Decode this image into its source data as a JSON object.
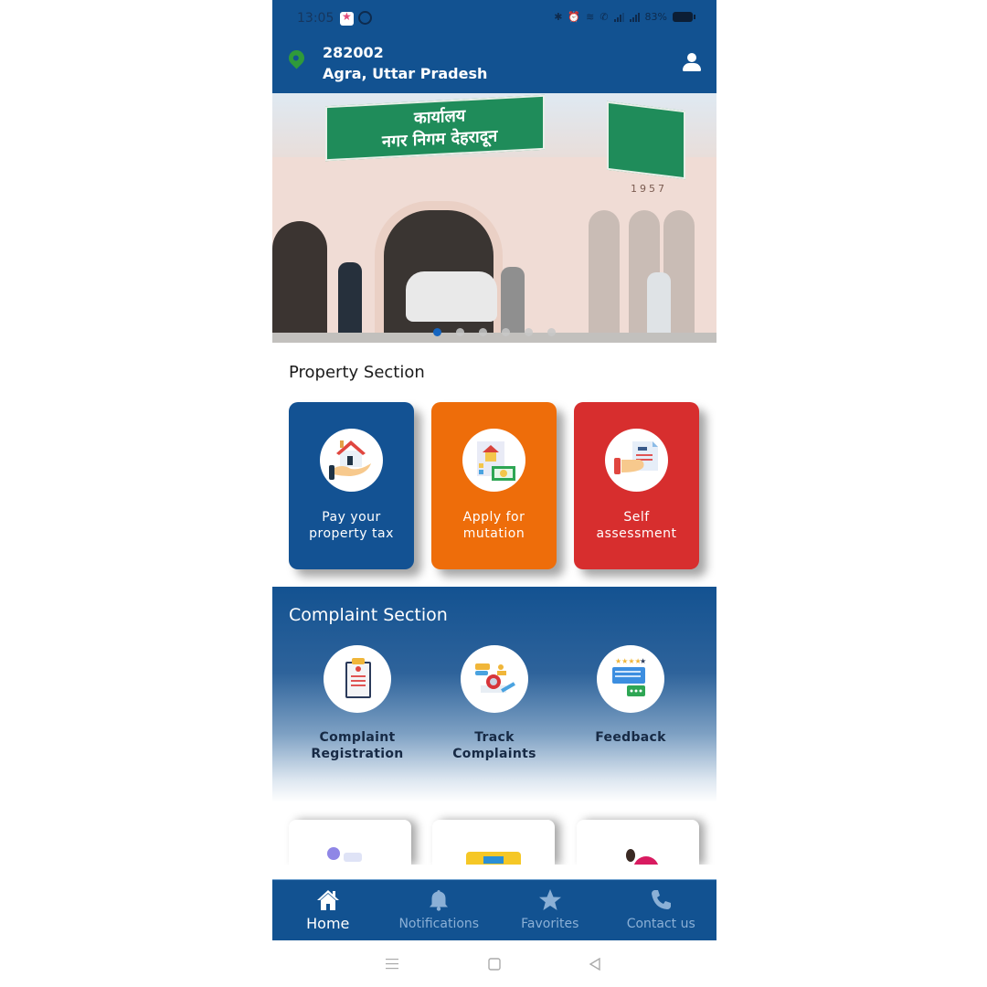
{
  "status_bar": {
    "time": "13:05",
    "notification_icons": [
      "app-notification-icon",
      "whatsapp-icon"
    ],
    "system_icons": [
      "bluetooth-icon",
      "alarm-icon",
      "wifi-icon",
      "volte-call-icon",
      "signal-icon",
      "signal-icon"
    ],
    "battery": "83%"
  },
  "header": {
    "pincode": "282002",
    "location": "Agra, Uttar Pradesh",
    "location_icon": "map-pin-icon",
    "profile_icon": "user-icon"
  },
  "banner": {
    "sign_text_line1": "कार्यालय",
    "sign_text_line2": "नगर निगम देहरादून",
    "building_year": "1957",
    "slide_count": 6,
    "active_slide": 1
  },
  "property_section": {
    "title": "Property Section",
    "cards": [
      {
        "label_line1": "Pay your",
        "label_line2": "property tax",
        "icon": "house-in-hand-icon",
        "color": "#135293"
      },
      {
        "label_line1": "Apply for",
        "label_line2": "mutation",
        "icon": "property-document-money-icon",
        "color": "#ee6d0a"
      },
      {
        "label_line1": "Self",
        "label_line2": "assessment",
        "icon": "hand-holding-document-icon",
        "color": "#d72e2e"
      }
    ]
  },
  "complaint_section": {
    "title": "Complaint Section",
    "items": [
      {
        "label_line1": "Complaint",
        "label_line2": "Registration",
        "icon": "clipboard-complaint-icon"
      },
      {
        "label_line1": "Track",
        "label_line2": "Complaints",
        "icon": "track-certificate-icon"
      },
      {
        "label_line1": "Feedback",
        "label_line2": "",
        "icon": "feedback-chat-rating-icon"
      }
    ]
  },
  "more_cards": [
    {
      "icon": "user-id-card-icon"
    },
    {
      "icon": "ticket-stars-icon"
    },
    {
      "icon": "person-with-ring-icon"
    }
  ],
  "bottom_nav": {
    "items": [
      {
        "label": "Home",
        "icon": "home-icon",
        "active": true
      },
      {
        "label": "Notifications",
        "icon": "bell-icon",
        "active": false
      },
      {
        "label": "Favorites",
        "icon": "star-icon",
        "active": false
      },
      {
        "label": "Contact us",
        "icon": "phone-icon",
        "active": false
      }
    ]
  },
  "system_nav": [
    "menu-icon",
    "home-square-icon",
    "back-triangle-icon"
  ],
  "colors": {
    "primary": "#125291",
    "orange": "#ee6d0a",
    "red": "#d72e2e",
    "pin_green": "#2f9a3a",
    "nav_inactive": "#8bb0d6"
  }
}
